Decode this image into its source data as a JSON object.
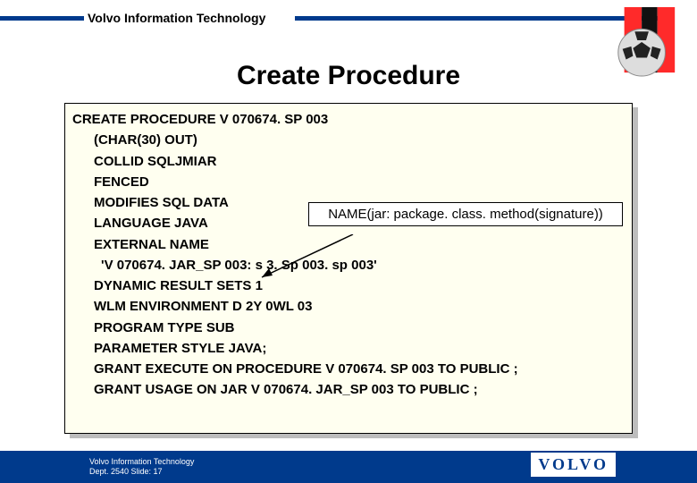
{
  "header": {
    "org_name": "Volvo Information Technology"
  },
  "slide": {
    "title": "Create Procedure"
  },
  "callout": {
    "name_format": "NAME(jar: package. class. method(signature))"
  },
  "code": {
    "l1": "CREATE PROCEDURE V 070674. SP 003",
    "l2": "(CHAR(30) OUT)",
    "l3": "COLLID SQLJMIAR",
    "l4": "FENCED",
    "l5": "MODIFIES SQL DATA",
    "l6": "LANGUAGE JAVA",
    "l7": "EXTERNAL NAME",
    "l8": "'V 070674. JAR_SP 003: s 3. Sp 003. sp 003'",
    "l9": "DYNAMIC RESULT SETS 1",
    "l10": "WLM ENVIRONMENT D 2Y 0WL 03",
    "l11": "PROGRAM TYPE SUB",
    "l12": "PARAMETER STYLE JAVA;",
    "l13": "GRANT EXECUTE ON PROCEDURE V 070674. SP 003 TO PUBLIC ;",
    "l14": "GRANT USAGE ON JAR V 070674. JAR_SP 003 TO PUBLIC ;"
  },
  "footer": {
    "line1": "Volvo Information Technology",
    "line2": "Dept. 2540        Slide:  17",
    "logo_text": "VOLVO"
  }
}
